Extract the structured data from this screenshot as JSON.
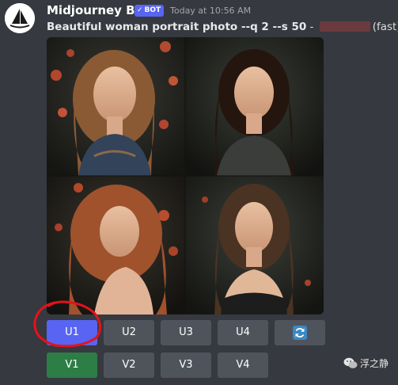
{
  "message": {
    "username": "Midjourney Bot",
    "bot_badge": "BOT",
    "timestamp": "Today at 10:56 AM",
    "prompt": "Beautiful woman portrait photo --q 2 --s 50",
    "separator": " - ",
    "mode": "(fast)",
    "image_alt": "2x2 grid of four portraits of a woman"
  },
  "buttons": {
    "row1": [
      "U1",
      "U2",
      "U3",
      "U4"
    ],
    "row2": [
      "V1",
      "V2",
      "V3",
      "V4"
    ],
    "reroll_icon": "refresh-icon"
  },
  "colors": {
    "background": "#36393f",
    "blurple": "#5865f2",
    "secondary": "#4f545c",
    "green": "#2d7d46",
    "annotation_red": "#e3131b"
  },
  "watermark": {
    "text": "浮之静",
    "icon": "wechat-icon"
  }
}
